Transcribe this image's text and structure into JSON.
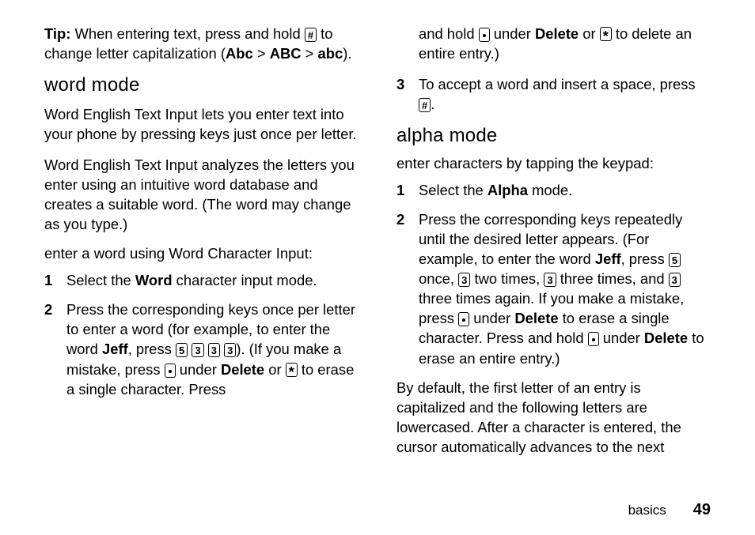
{
  "left": {
    "tip_label": "Tip:",
    "tip_a": " When entering text, press and hold ",
    "tip_key": "#",
    "tip_b": " to change letter capitalization (",
    "tip_seq_1": "Abc",
    "tip_gt1": " > ",
    "tip_seq_2": "ABC",
    "tip_gt2": " > ",
    "tip_seq_3": "abc",
    "tip_c": ").",
    "h_word": "word mode",
    "p_word_1": "Word English Text Input lets you enter text into your phone by pressing keys just once per letter.",
    "p_word_2": "Word English Text Input analyzes the letters you enter using an intuitive word database and creates a suitable word. (The word may change as you type.)",
    "h_sub_word": "enter a word using Word Character Input:",
    "step1_a": "Select the ",
    "step1_b": "Word",
    "step1_c": " character input mode.",
    "step2_a": "Press the corresponding keys once per letter to enter a word (for example, to enter the word ",
    "step2_jeff": "Jeff",
    "step2_b": ", press ",
    "key5": "5",
    "key3": "3",
    "step2_c": "). (If you make a mistake, press ",
    "step2_d": " under ",
    "step2_del": "Delete",
    "step2_e": " or ",
    "step2_f": " to erase a single character. Press"
  },
  "right": {
    "cont_a": "and hold ",
    "cont_b": " under ",
    "cont_del": "Delete",
    "cont_c": " or ",
    "cont_d": " to delete an entire entry.)",
    "step3_a": "To accept a word and insert a space, press ",
    "step3_key": "#",
    "step3_b": ".",
    "h_alpha": "alpha mode",
    "h_sub_alpha": "enter characters by tapping the keypad:",
    "a_step1_a": "Select the ",
    "a_step1_b": "Alpha",
    "a_step1_c": " mode.",
    "a_step2_a": "Press the corresponding keys repeatedly until the desired letter appears. (For example, to enter the word ",
    "a_step2_jeff": "Jeff",
    "a_step2_b": ", press ",
    "key5b": "5",
    "a_step2_c": " once, ",
    "key3b": "3",
    "a_step2_d": " two times, ",
    "a_step2_e": " three times, and ",
    "a_step2_f": " three times again. If you make a mistake, press ",
    "a_step2_g": " under ",
    "a_step2_del": "Delete",
    "a_step2_h": " to erase a single character. Press and hold ",
    "a_step2_i": " under ",
    "a_step2_j": " to erase an entire entry.)",
    "p_final": "By default, the first letter of an entry is capitalized and the following letters are lowercased. After a character is entered, the cursor automatically advances to the next"
  },
  "footer": {
    "label": "basics",
    "page": "49"
  },
  "nums": {
    "n1": "1",
    "n2": "2",
    "n3": "3"
  }
}
